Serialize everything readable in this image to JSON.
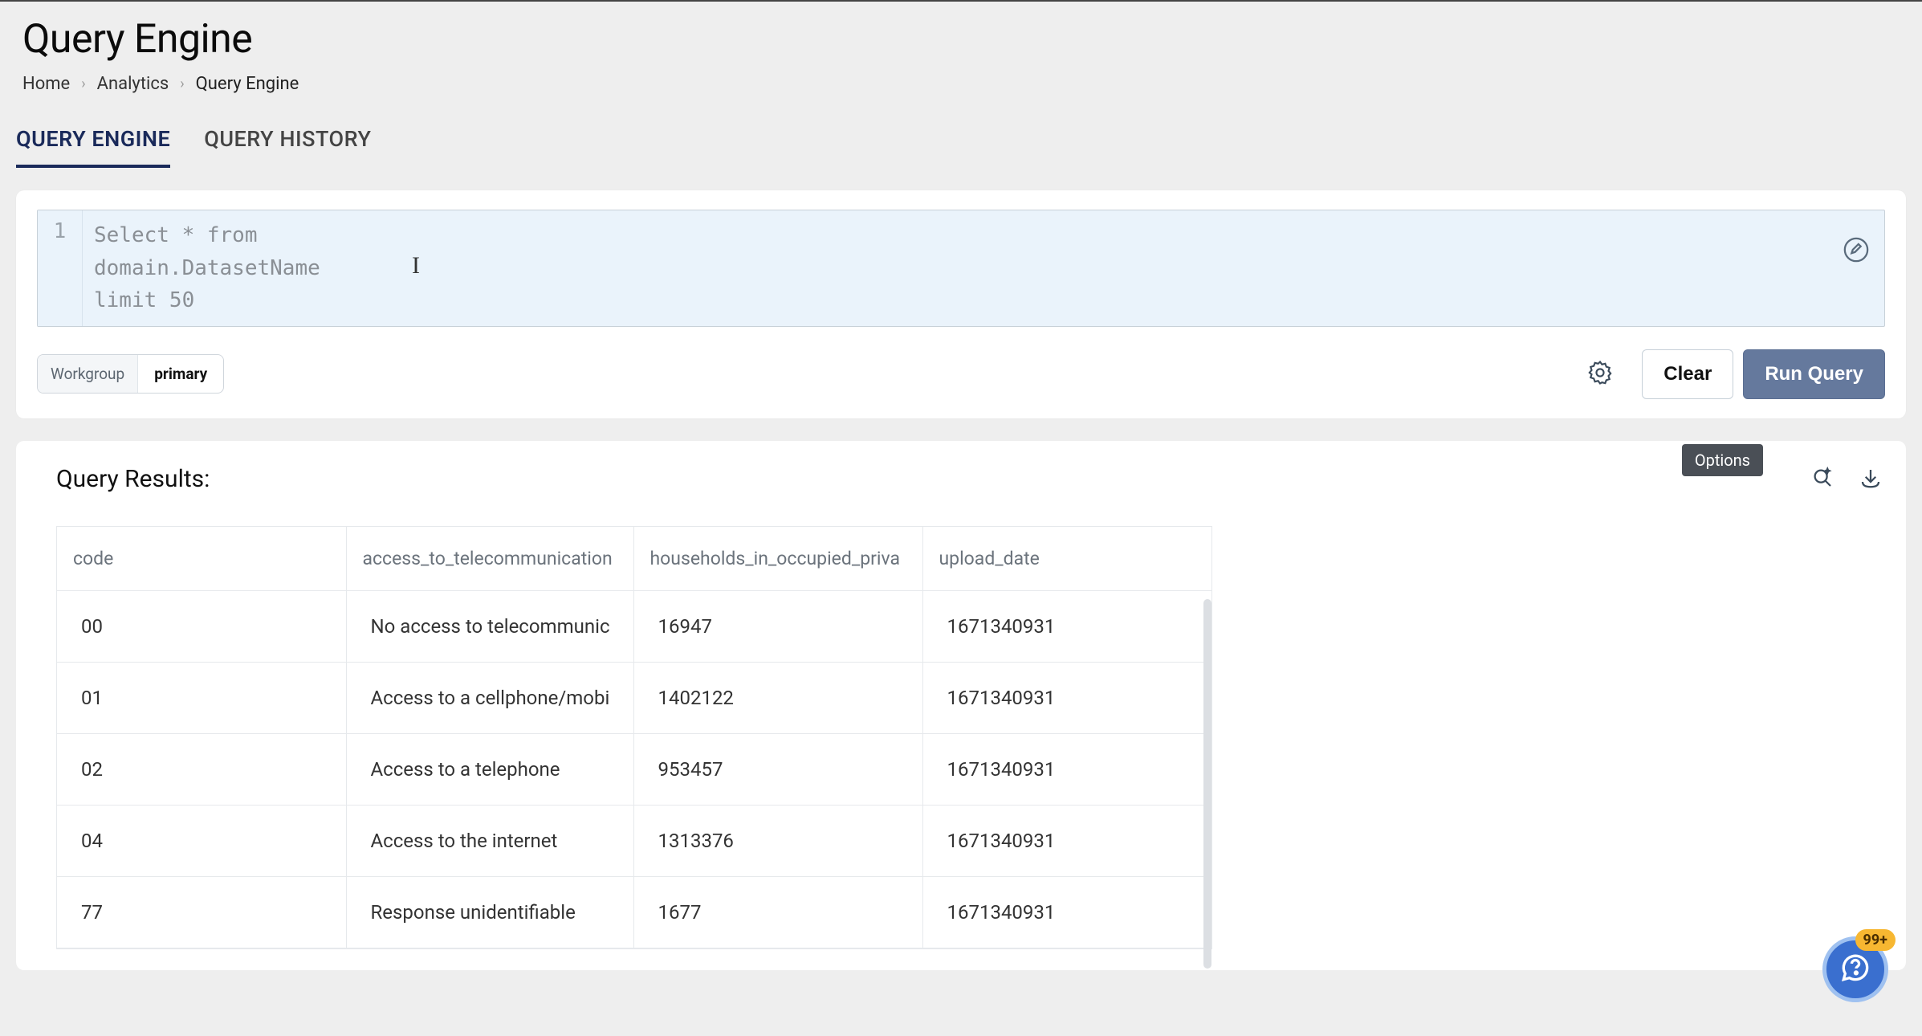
{
  "header": {
    "title": "Query Engine",
    "breadcrumb": [
      "Home",
      "Analytics",
      "Query Engine"
    ]
  },
  "tabs": [
    {
      "label": "QUERY ENGINE",
      "active": true
    },
    {
      "label": "QUERY HISTORY",
      "active": false
    }
  ],
  "editor": {
    "line_number": "1",
    "content": "Select * from\ndomain.DatasetName\nlimit 50"
  },
  "workgroup": {
    "label": "Workgroup",
    "value": "primary"
  },
  "actions": {
    "clear": "Clear",
    "run": "Run Query"
  },
  "results": {
    "title": "Query Results:",
    "options_label": "Options",
    "columns": [
      "code",
      "access_to_telecommunication",
      "households_in_occupied_priva",
      "upload_date"
    ],
    "rows": [
      {
        "code": "00",
        "access": "No access to telecommunic",
        "households": "16947",
        "upload": "1671340931"
      },
      {
        "code": "01",
        "access": "Access to a cellphone/mobi",
        "households": "1402122",
        "upload": "1671340931"
      },
      {
        "code": "02",
        "access": "Access to a telephone",
        "households": "953457",
        "upload": "1671340931"
      },
      {
        "code": "04",
        "access": "Access to the internet",
        "households": "1313376",
        "upload": "1671340931"
      },
      {
        "code": "77",
        "access": "Response unidentifiable",
        "households": "1677",
        "upload": "1671340931"
      }
    ]
  },
  "support": {
    "badge": "99+"
  }
}
